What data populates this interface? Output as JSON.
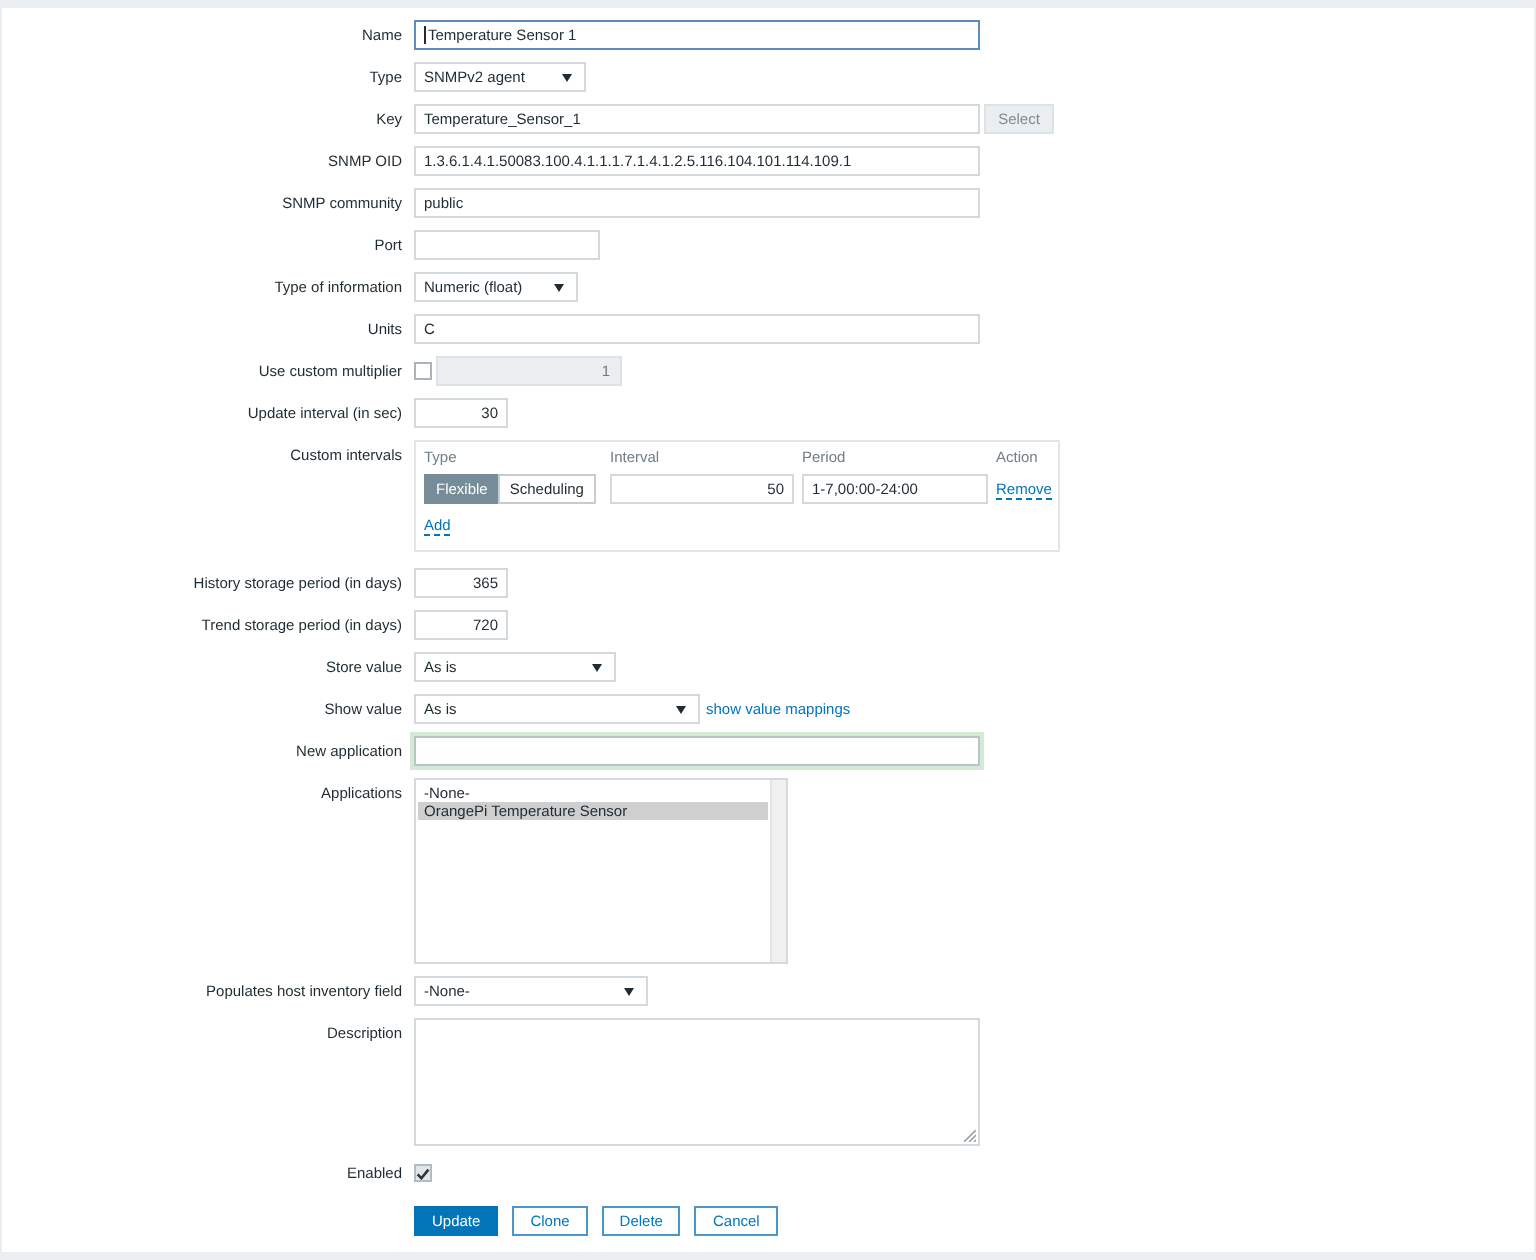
{
  "form": {
    "rows": [
      {
        "kind": "text",
        "label": "Name",
        "value": "Temperature Sensor 1",
        "focused": true
      },
      {
        "kind": "select",
        "label": "Type",
        "value": "SNMPv2 agent"
      },
      {
        "kind": "text",
        "label": "Key",
        "value": "Temperature_Sensor_1",
        "focused": false,
        "button": {
          "label": "Select",
          "disabled": true
        }
      },
      {
        "kind": "text",
        "label": "SNMP OID",
        "value": "1.3.6.1.4.1.50083.100.4.1.1.1.7.1.4.1.2.5.116.104.101.114.109.1",
        "focused": false
      },
      {
        "kind": "text",
        "label": "SNMP community",
        "value": "public",
        "focused": false
      },
      {
        "kind": "text",
        "label": "Port",
        "focused": false
      },
      {
        "kind": "select",
        "label": "Type of information",
        "value": "Numeric (float)"
      },
      {
        "kind": "text",
        "label": "Units",
        "value": "C",
        "focused": false
      },
      {
        "kind": "multiplier",
        "label": "Use custom multiplier",
        "checked": false,
        "value": "1",
        "disabled": true
      },
      {
        "kind": "number",
        "label": "Update interval (in sec)",
        "value": "30"
      },
      {
        "kind": "intervals",
        "label": "Custom intervals",
        "columns": [
          "Type",
          "Interval",
          "Period",
          "Action"
        ],
        "rows": [
          {
            "modes": [
              {
                "label": "Flexible",
                "selected": true
              },
              {
                "label": "Scheduling",
                "selected": false
              }
            ],
            "interval": "50",
            "period": "1-7,00:00-24:00",
            "action": "Remove"
          }
        ],
        "add_link": "Add"
      },
      {
        "kind": "number",
        "label": "History storage period (in days)",
        "value": "365"
      },
      {
        "kind": "number",
        "label": "Trend storage period (in days)",
        "value": "720"
      },
      {
        "kind": "select",
        "label": "Store value",
        "value": "As is"
      },
      {
        "kind": "select",
        "label": "Show value",
        "value": "As is",
        "link": "show value mappings"
      },
      {
        "kind": "text",
        "label": "New application",
        "focused": false,
        "highlighted": true
      },
      {
        "kind": "listbox",
        "label": "Applications",
        "options": [
          {
            "label": "-None-",
            "selected": false
          },
          {
            "label": "OrangePi Temperature Sensor",
            "selected": true
          }
        ]
      },
      {
        "kind": "select",
        "label": "Populates host inventory field",
        "value": "-None-"
      },
      {
        "kind": "textarea",
        "label": "Description"
      },
      {
        "kind": "checkbox",
        "label": "Enabled",
        "checked": true
      }
    ],
    "buttons": [
      {
        "label": "Update",
        "primary": true
      },
      {
        "label": "Clone",
        "primary": false
      },
      {
        "label": "Delete",
        "primary": false
      },
      {
        "label": "Cancel",
        "primary": false
      }
    ]
  }
}
